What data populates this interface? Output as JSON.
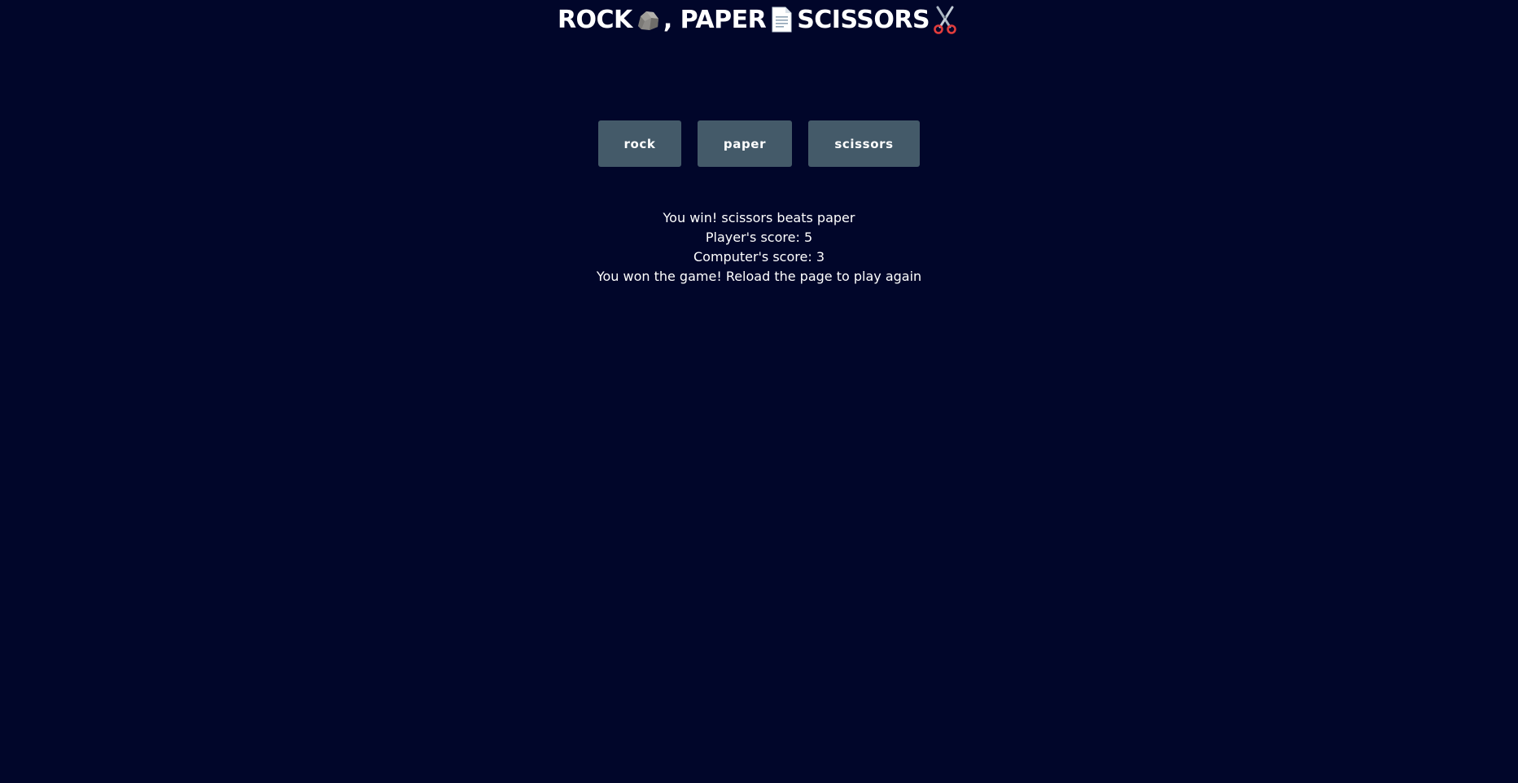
{
  "header": {
    "title_parts": [
      "ROCK",
      ", PAPER",
      " SCISSORS"
    ],
    "icons": [
      "rock-icon",
      "paper-icon",
      "scissors-icon"
    ]
  },
  "buttons": {
    "rock": "rock",
    "paper": "paper",
    "scissors": "scissors"
  },
  "results": {
    "round_message": "You win! scissors beats paper",
    "player_score": "Player's score: 5",
    "computer_score": "Computer's score: 3",
    "game_over": "You won the game! Reload the page to play again"
  },
  "colors": {
    "background": "#01062a",
    "button": "#445a69",
    "text": "#ffffff"
  }
}
